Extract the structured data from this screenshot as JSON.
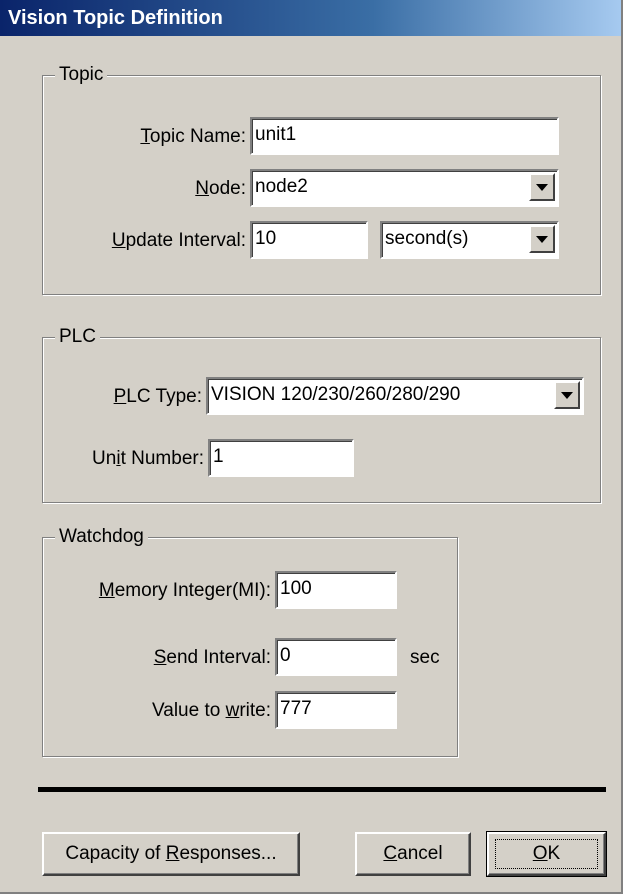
{
  "window": {
    "title": "Vision Topic Definition"
  },
  "topic": {
    "legend": "Topic",
    "topic_name": {
      "label_pre": "",
      "label_key": "T",
      "label_post": "opic Name:",
      "value": "unit1"
    },
    "node": {
      "label_pre": "",
      "label_key": "N",
      "label_post": "ode:",
      "value": "node2"
    },
    "update_interval": {
      "label_pre": "",
      "label_key": "U",
      "label_post": "pdate Interval:",
      "value": "10",
      "unit": "second(s)"
    }
  },
  "plc": {
    "legend": "PLC",
    "plc_type": {
      "label_pre": "",
      "label_key": "P",
      "label_post": "LC Type:",
      "value": "VISION 120/230/260/280/290"
    },
    "unit_number": {
      "label_pre": "Un",
      "label_key": "i",
      "label_post": "t Number:",
      "value": "1"
    }
  },
  "watchdog": {
    "legend": "Watchdog",
    "memory_integer": {
      "label_pre": "",
      "label_key": "M",
      "label_post": "emory Integer(MI):",
      "value": "100"
    },
    "send_interval": {
      "label_pre": "",
      "label_key": "S",
      "label_post": "end Interval:",
      "value": "0",
      "unit": "sec"
    },
    "value_to_write": {
      "label_pre": "Value to ",
      "label_key": "w",
      "label_post": "rite:",
      "value": "777"
    }
  },
  "buttons": {
    "capacity": {
      "pre": "Capacity of ",
      "key": "R",
      "post": "esponses..."
    },
    "cancel": {
      "pre": "",
      "key": "C",
      "post": "ancel"
    },
    "ok": {
      "pre": "",
      "key": "O",
      "post": "K"
    }
  }
}
